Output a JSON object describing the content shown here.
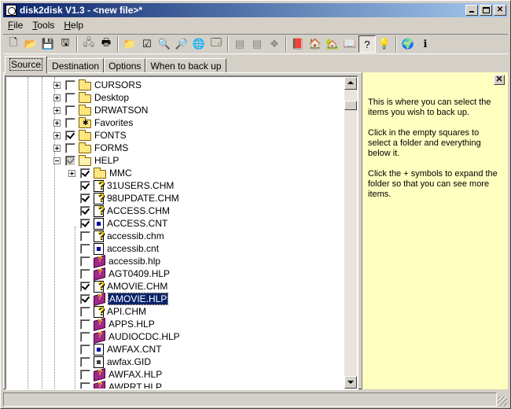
{
  "window": {
    "title": "disk2disk V1.3 - <new file>*"
  },
  "menu": [
    {
      "label": "File",
      "u": "F",
      "rest": "ile"
    },
    {
      "label": "Tools",
      "u": "T",
      "rest": "ools"
    },
    {
      "label": "Help",
      "u": "H",
      "rest": "elp"
    }
  ],
  "tabs": [
    "Source",
    "Destination",
    "Options",
    "When to back up"
  ],
  "tree": [
    {
      "label": "CURSORS",
      "icon": "folder",
      "expander": "plus",
      "check": "none",
      "level": 0
    },
    {
      "label": "Desktop",
      "icon": "folder",
      "expander": "plus",
      "check": "none",
      "level": 0
    },
    {
      "label": "DRWATSON",
      "icon": "folder",
      "expander": "plus",
      "check": "none",
      "level": 0
    },
    {
      "label": "Favorites",
      "icon": "favorites",
      "expander": "plus",
      "check": "none",
      "level": 0
    },
    {
      "label": "FONTS",
      "icon": "folder",
      "expander": "plus",
      "check": "checked",
      "level": 0
    },
    {
      "label": "FORMS",
      "icon": "folder",
      "expander": "plus",
      "check": "none",
      "level": 0
    },
    {
      "label": "HELP",
      "icon": "folder-open",
      "expander": "minus",
      "check": "grayed",
      "level": 0
    },
    {
      "label": "MMC",
      "icon": "folder",
      "expander": "plus",
      "check": "checked",
      "level": 1
    },
    {
      "label": "31USERS.CHM",
      "icon": "chm",
      "expander": "",
      "check": "checked",
      "level": 1
    },
    {
      "label": "98UPDATE.CHM",
      "icon": "chm",
      "expander": "",
      "check": "checked",
      "level": 1
    },
    {
      "label": "ACCESS.CHM",
      "icon": "chm",
      "expander": "",
      "check": "checked",
      "level": 1
    },
    {
      "label": "ACCESS.CNT",
      "icon": "cnt",
      "expander": "",
      "check": "checked",
      "level": 1
    },
    {
      "label": "accessib.chm",
      "icon": "chm",
      "expander": "",
      "check": "none",
      "level": 1
    },
    {
      "label": "accessib.cnt",
      "icon": "cnt",
      "expander": "",
      "check": "none",
      "level": 1
    },
    {
      "label": "accessib.hlp",
      "icon": "hlp",
      "expander": "",
      "check": "none",
      "level": 1
    },
    {
      "label": "AGT0409.HLP",
      "icon": "hlp",
      "expander": "",
      "check": "none",
      "level": 1
    },
    {
      "label": "AMOVIE.CHM",
      "icon": "chm",
      "expander": "",
      "check": "checked",
      "level": 1
    },
    {
      "label": "AMOVIE.HLP",
      "icon": "hlp",
      "expander": "",
      "check": "checked",
      "level": 1,
      "selected": true
    },
    {
      "label": "API.CHM",
      "icon": "chm",
      "expander": "",
      "check": "none",
      "level": 1
    },
    {
      "label": "APPS.HLP",
      "icon": "hlp",
      "expander": "",
      "check": "none",
      "level": 1
    },
    {
      "label": "AUDIOCDC.HLP",
      "icon": "hlp",
      "expander": "",
      "check": "none",
      "level": 1
    },
    {
      "label": "AWFAX.CNT",
      "icon": "cnt",
      "expander": "",
      "check": "none",
      "level": 1
    },
    {
      "label": "awfax.GID",
      "icon": "gid",
      "expander": "",
      "check": "none",
      "level": 1
    },
    {
      "label": "AWFAX.HLP",
      "icon": "hlp",
      "expander": "",
      "check": "none",
      "level": 1
    },
    {
      "label": "AWPRT.HLP",
      "icon": "hlp",
      "expander": "",
      "check": "none",
      "level": 1
    }
  ],
  "help": {
    "paragraphs": [
      "This is where you can select the items you wish to back up.",
      "Click in the empty squares to select a folder and everything below it.",
      "Click the + symbols to expand the folder so that you can see more items."
    ]
  }
}
